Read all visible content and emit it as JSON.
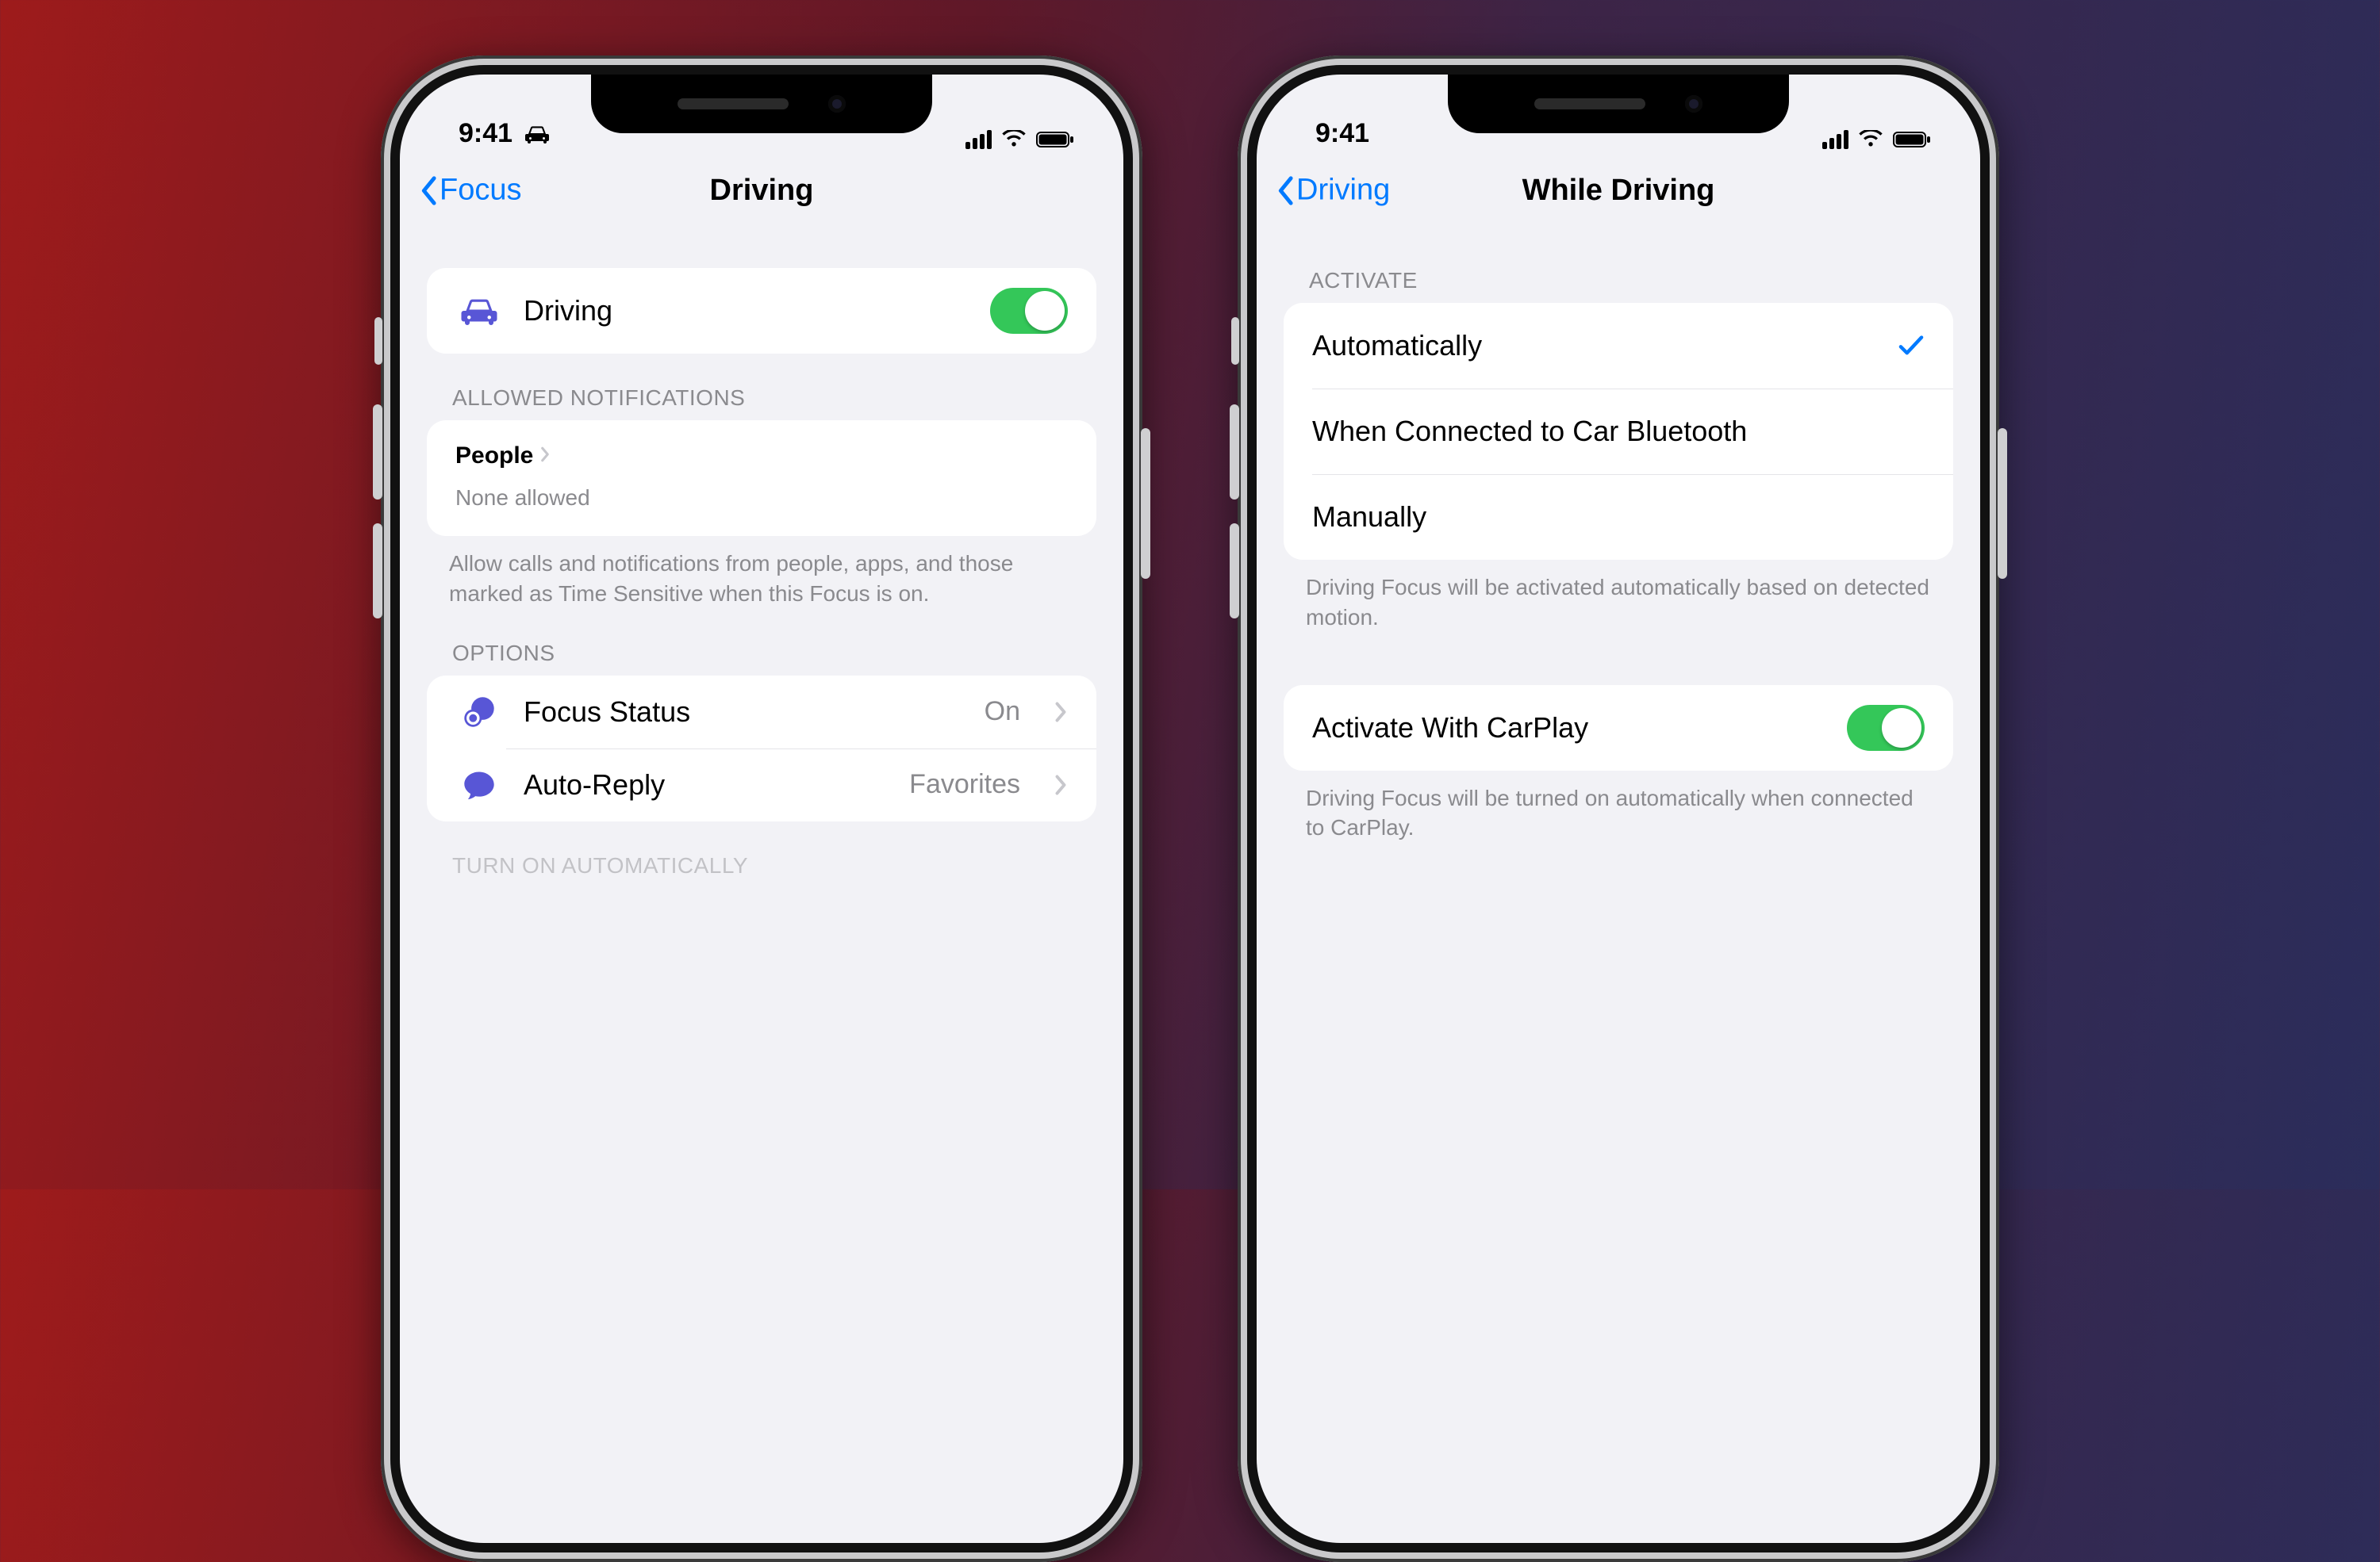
{
  "statusBar": {
    "time": "9:41"
  },
  "left": {
    "back": "Focus",
    "title": "Driving",
    "drivingToggle": {
      "label": "Driving",
      "on": true
    },
    "allowed": {
      "header": "ALLOWED NOTIFICATIONS",
      "peopleLabel": "People",
      "peopleValue": "None allowed",
      "footer": "Allow calls and notifications from people, apps, and those marked as Time Sensitive when this Focus is on."
    },
    "options": {
      "header": "OPTIONS",
      "focusStatus": {
        "label": "Focus Status",
        "value": "On"
      },
      "autoReply": {
        "label": "Auto-Reply",
        "value": "Favorites"
      }
    },
    "turnOnHeader": "TURN ON AUTOMATICALLY"
  },
  "right": {
    "back": "Driving",
    "title": "While Driving",
    "activate": {
      "header": "ACTIVATE",
      "options": [
        {
          "label": "Automatically",
          "selected": true
        },
        {
          "label": "When Connected to Car Bluetooth",
          "selected": false
        },
        {
          "label": "Manually",
          "selected": false
        }
      ],
      "footer": "Driving Focus will be activated automatically based on detected motion."
    },
    "carplay": {
      "label": "Activate With CarPlay",
      "on": true,
      "footer": "Driving Focus will be turned on automatically when connected to CarPlay."
    }
  },
  "colors": {
    "accent": "#007aff",
    "switchOn": "#34c759",
    "carIndigo": "#5856d6",
    "focusStatusIcon": "#5856d6",
    "autoReplyIcon": "#5856d6"
  }
}
